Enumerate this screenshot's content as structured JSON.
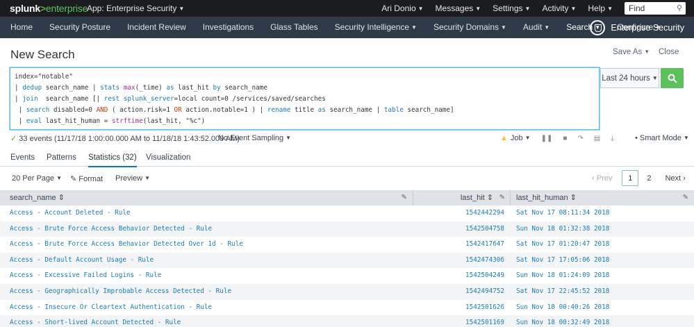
{
  "topbar": {
    "brand_main": "splunk",
    "brand_gt": ">",
    "brand_sub": "enterprise",
    "app_menu": "App: Enterprise Security",
    "user": "Ari Donio",
    "messages": "Messages",
    "settings": "Settings",
    "activity": "Activity",
    "help": "Help",
    "find_placeholder": "Find"
  },
  "appnav": {
    "items": [
      {
        "label": "Home"
      },
      {
        "label": "Security Posture"
      },
      {
        "label": "Incident Review"
      },
      {
        "label": "Investigations"
      },
      {
        "label": "Glass Tables"
      },
      {
        "label": "Security Intelligence"
      },
      {
        "label": "Security Domains"
      },
      {
        "label": "Audit"
      },
      {
        "label": "Search"
      },
      {
        "label": "Configure"
      }
    ],
    "app_title": "Enterprise Security"
  },
  "page": {
    "title": "New Search",
    "save_as": "Save As",
    "close": "Close"
  },
  "search": {
    "lines": [
      "index=\"notable\"",
      "| dedup search_name | stats max(_time) as last_hit by search_name",
      "| join  search_name [| rest splunk_server=local count=0 /services/saved/searches",
      " | search disabled=0 AND ( action.risk=1 OR action.notable=1 ) | rename title as search_name | table search_name]",
      " | eval last_hit_human = strftime(last_hit, \"%c\")"
    ],
    "time_range": "Last 24 hours"
  },
  "status": {
    "events": "33 events (11/17/18 1:00:00.000 AM to 11/18/18 1:43:52.000 AM)",
    "sampling": "No Event Sampling",
    "job": "Job",
    "mode": "Smart Mode"
  },
  "tabs": [
    {
      "label": "Events"
    },
    {
      "label": "Patterns"
    },
    {
      "label": "Statistics (32)"
    },
    {
      "label": "Visualization"
    }
  ],
  "toolbar": {
    "per_page": "20 Per Page",
    "format": "Format",
    "preview": "Preview",
    "prev": "Prev",
    "page1": "1",
    "page2": "2",
    "next": "Next"
  },
  "table": {
    "columns": [
      "search_name",
      "last_hit",
      "last_hit_human"
    ],
    "rows": [
      [
        "Access - Account Deleted - Rule",
        "1542442294",
        "Sat Nov 17 08:11:34 2018"
      ],
      [
        "Access - Brute Force Access Behavior Detected - Rule",
        "1542504758",
        "Sun Nov 18 01:32:38 2018"
      ],
      [
        "Access - Brute Force Access Behavior Detected Over 1d - Rule",
        "1542417647",
        "Sat Nov 17 01:20:47 2018"
      ],
      [
        "Access - Default Account Usage - Rule",
        "1542474306",
        "Sat Nov 17 17:05:06 2018"
      ],
      [
        "Access - Excessive Failed Logins - Rule",
        "1542504249",
        "Sun Nov 18 01:24:09 2018"
      ],
      [
        "Access - Geographically Improbable Access Detected - Rule",
        "1542494752",
        "Sat Nov 17 22:45:52 2018"
      ],
      [
        "Access - Insecure Or Cleartext Authentication - Rule",
        "1542501626",
        "Sun Nov 18 00:40:26 2018"
      ],
      [
        "Access - Short-lived Account Detected - Rule",
        "1542501169",
        "Sun Nov 18 00:32:49 2018"
      ]
    ]
  }
}
